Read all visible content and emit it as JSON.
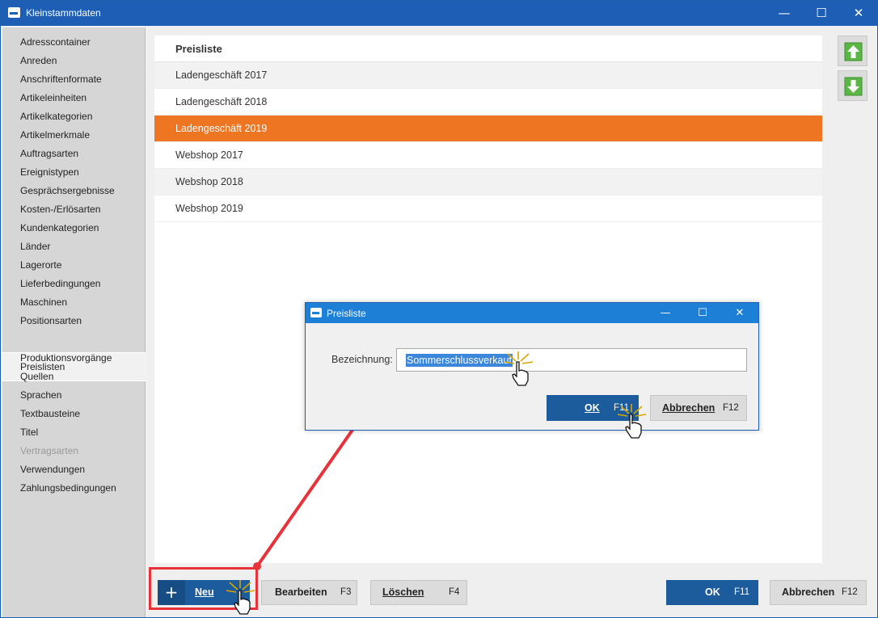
{
  "window": {
    "title": "Kleinstammdaten",
    "minimize_glyph": "—",
    "maximize_glyph": "☐",
    "close_glyph": "✕"
  },
  "sidebar": {
    "items": [
      {
        "label": "Adresscontainer"
      },
      {
        "label": "Anreden"
      },
      {
        "label": "Anschriftenformate"
      },
      {
        "label": "Artikeleinheiten"
      },
      {
        "label": "Artikelkategorien"
      },
      {
        "label": "Artikelmerkmale"
      },
      {
        "label": "Auftragsarten"
      },
      {
        "label": "Ereignistypen"
      },
      {
        "label": "Gesprächsergebnisse"
      },
      {
        "label": "Kosten-/Erlösarten"
      },
      {
        "label": "Kundenkategorien"
      },
      {
        "label": "Länder"
      },
      {
        "label": "Lagerorte"
      },
      {
        "label": "Lieferbedingungen"
      },
      {
        "label": "Maschinen"
      },
      {
        "label": "Positionsarten"
      },
      {
        "label": "Preislisten",
        "selected": true
      },
      {
        "label": "Produktionsvorgänge"
      },
      {
        "label": "Quellen"
      },
      {
        "label": "Sprachen"
      },
      {
        "label": "Textbausteine"
      },
      {
        "label": "Titel"
      },
      {
        "label": "Vertragsarten",
        "disabled": true
      },
      {
        "label": "Verwendungen"
      },
      {
        "label": "Zahlungsbedingungen"
      }
    ]
  },
  "list": {
    "header": "Preisliste",
    "rows": [
      {
        "label": "Ladengeschäft 2017"
      },
      {
        "label": "Ladengeschäft 2018"
      },
      {
        "label": "Ladengeschäft 2019",
        "selected": true
      },
      {
        "label": "Webshop 2017"
      },
      {
        "label": "Webshop 2018"
      },
      {
        "label": "Webshop 2019"
      }
    ]
  },
  "side_buttons": {
    "up_icon": "arrow-up-icon",
    "down_icon": "arrow-down-icon",
    "accent_color": "#5bb745"
  },
  "toolbar": {
    "new": {
      "label": "Neu",
      "icon": "plus-icon"
    },
    "edit": {
      "label": "Bearbeiten",
      "key": "F3"
    },
    "delete": {
      "label": "Löschen",
      "key": "F4"
    },
    "ok": {
      "label": "OK",
      "key": "F11"
    },
    "cancel": {
      "label": "Abbrechen",
      "key": "F12"
    }
  },
  "dialog": {
    "title": "Preisliste",
    "field_label": "Bezeichnung:",
    "field_value": "Sommerschlussverkauf",
    "ok": {
      "label": "OK",
      "key": "F11"
    },
    "cancel": {
      "label": "Abbrechen",
      "key": "F12"
    },
    "minimize_glyph": "—",
    "maximize_glyph": "☐",
    "close_glyph": "✕"
  },
  "colors": {
    "titlebar": "#1e5fb5",
    "selected_row": "#ee7623",
    "primary_button": "#1c5b9c",
    "annotation_red": "#e8323a"
  }
}
